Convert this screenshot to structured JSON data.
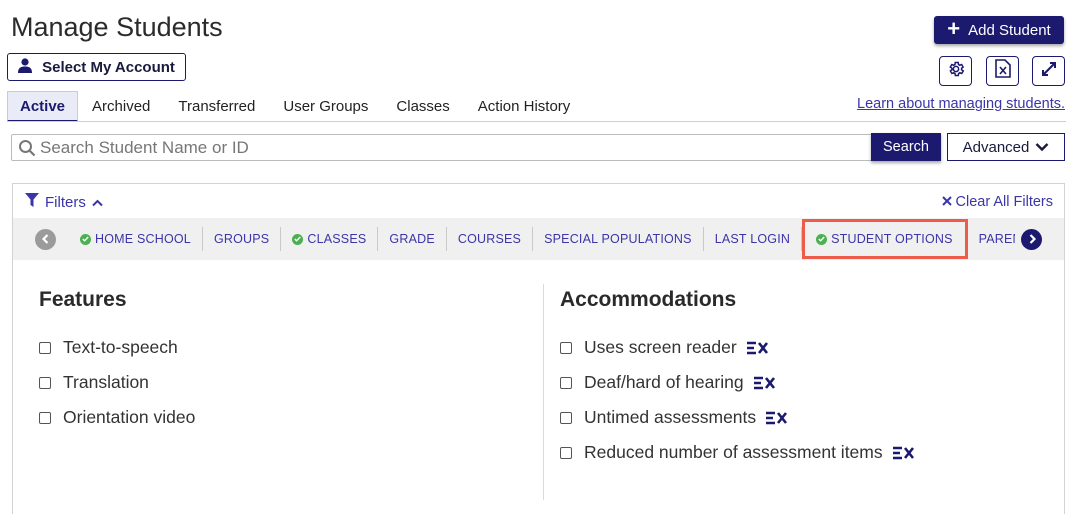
{
  "page": {
    "title": "Manage Students"
  },
  "header": {
    "add_student_label": "Add Student",
    "select_account_label": "Select My Account"
  },
  "toolbar_icons": [
    "gear-icon",
    "excel-export-icon",
    "expand-icon"
  ],
  "tabs": [
    {
      "label": "Active",
      "active": true
    },
    {
      "label": "Archived"
    },
    {
      "label": "Transferred"
    },
    {
      "label": "User Groups"
    },
    {
      "label": "Classes"
    },
    {
      "label": "Action History"
    }
  ],
  "learn_link": "Learn about managing students.",
  "search": {
    "placeholder": "Search Student Name or ID",
    "button_label": "Search",
    "advanced_label": "Advanced"
  },
  "filters": {
    "toggle_label": "Filters",
    "clear_all_label": "Clear All Filters",
    "chips": [
      {
        "label": "HOME SCHOOL",
        "checked": true
      },
      {
        "label": "GROUPS",
        "checked": false
      },
      {
        "label": "CLASSES",
        "checked": true
      },
      {
        "label": "GRADE",
        "checked": false
      },
      {
        "label": "COURSES",
        "checked": false
      },
      {
        "label": "SPECIAL POPULATIONS",
        "checked": false
      },
      {
        "label": "LAST LOGIN",
        "checked": false
      },
      {
        "label": "STUDENT OPTIONS",
        "checked": true,
        "highlighted": true
      },
      {
        "label": "PARENT/GUARDIAN",
        "checked": false
      }
    ]
  },
  "features": {
    "title": "Features",
    "options": [
      "Text-to-speech",
      "Translation",
      "Orientation video"
    ]
  },
  "accommodations": {
    "title": "Accommodations",
    "options": [
      "Uses screen reader",
      "Deaf/hard of hearing",
      "Untimed assessments",
      "Reduced number of assessment items"
    ]
  },
  "colors": {
    "primary": "#1b1a6e",
    "link": "#3b35a8",
    "check": "#4caf50",
    "highlight": "#ef5b4b"
  }
}
